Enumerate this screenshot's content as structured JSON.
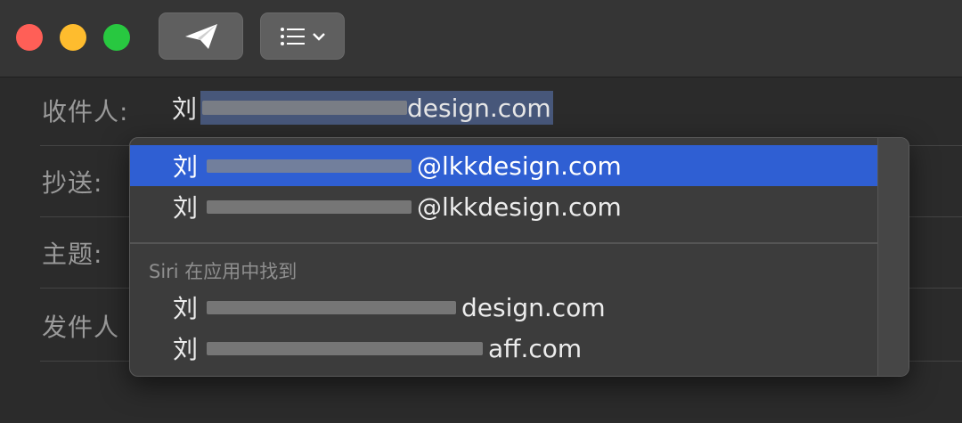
{
  "toolbar": {
    "send_icon": "paper-plane-icon",
    "format_icon": "list-icon"
  },
  "fields": {
    "to_label": "收件人:",
    "cc_label": "抄送:",
    "subject_label": "主题:",
    "from_label": "发件人"
  },
  "to_value": {
    "name": "刘",
    "email_tail": "design.com"
  },
  "suggestions": {
    "items": [
      {
        "name": "刘",
        "email": "@lkkdesign.com"
      },
      {
        "name": "刘",
        "email": "@lkkdesign.com"
      }
    ],
    "siri_header": "Siri 在应用中找到",
    "siri_items": [
      {
        "name": "刘",
        "email": "design.com"
      },
      {
        "name": "刘",
        "email": "aff.com"
      }
    ]
  },
  "colors": {
    "selection": "#2f5fd3",
    "traffic_red": "#ff5f57",
    "traffic_yellow": "#febc2e",
    "traffic_green": "#28c840"
  }
}
